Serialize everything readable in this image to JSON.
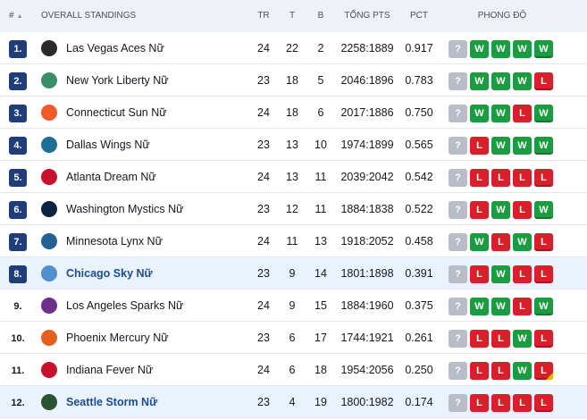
{
  "header": {
    "rank": "#",
    "overall": "OVERALL STANDINGS",
    "tr": "TR",
    "t": "T",
    "b": "B",
    "pts": "TỔNG PTS",
    "pct": "PCT",
    "form": "PHONG ĐỘ"
  },
  "rows": [
    {
      "rank": "1.",
      "team": "Las Vegas Aces Nữ",
      "tr": "24",
      "t": "22",
      "b": "2",
      "pts": "2258:1889",
      "pct": "0.917",
      "form": [
        "?",
        "W",
        "W",
        "W",
        "W"
      ],
      "logo_color": "#2b2b2b",
      "highlight": false,
      "boxed": true
    },
    {
      "rank": "2.",
      "team": "New York Liberty Nữ",
      "tr": "23",
      "t": "18",
      "b": "5",
      "pts": "2046:1896",
      "pct": "0.783",
      "form": [
        "?",
        "W",
        "W",
        "W",
        "L"
      ],
      "logo_color": "#3a8f6b",
      "highlight": false,
      "boxed": true
    },
    {
      "rank": "3.",
      "team": "Connecticut Sun Nữ",
      "tr": "24",
      "t": "18",
      "b": "6",
      "pts": "2017:1886",
      "pct": "0.750",
      "form": [
        "?",
        "W",
        "W",
        "L",
        "W"
      ],
      "logo_color": "#f05a28",
      "highlight": false,
      "boxed": true
    },
    {
      "rank": "4.",
      "team": "Dallas Wings Nữ",
      "tr": "23",
      "t": "13",
      "b": "10",
      "pts": "1974:1899",
      "pct": "0.565",
      "form": [
        "?",
        "L",
        "W",
        "W",
        "W"
      ],
      "logo_color": "#1d6f95",
      "highlight": false,
      "boxed": true
    },
    {
      "rank": "5.",
      "team": "Atlanta Dream Nữ",
      "tr": "24",
      "t": "13",
      "b": "11",
      "pts": "2039:2042",
      "pct": "0.542",
      "form": [
        "?",
        "L",
        "L",
        "L",
        "L"
      ],
      "logo_color": "#c8102e",
      "highlight": false,
      "boxed": true
    },
    {
      "rank": "6.",
      "team": "Washington Mystics Nữ",
      "tr": "23",
      "t": "12",
      "b": "11",
      "pts": "1884:1838",
      "pct": "0.522",
      "form": [
        "?",
        "L",
        "W",
        "L",
        "W"
      ],
      "logo_color": "#0c2340",
      "highlight": false,
      "boxed": true
    },
    {
      "rank": "7.",
      "team": "Minnesota Lynx Nữ",
      "tr": "24",
      "t": "11",
      "b": "13",
      "pts": "1918:2052",
      "pct": "0.458",
      "form": [
        "?",
        "W",
        "L",
        "W",
        "L"
      ],
      "logo_color": "#236192",
      "highlight": false,
      "boxed": true
    },
    {
      "rank": "8.",
      "team": "Chicago Sky Nữ",
      "tr": "23",
      "t": "9",
      "b": "14",
      "pts": "1801:1898",
      "pct": "0.391",
      "form": [
        "?",
        "L",
        "W",
        "L",
        "L"
      ],
      "logo_color": "#5091cd",
      "highlight": true,
      "boxed": true
    },
    {
      "rank": "9.",
      "team": "Los Angeles Sparks Nữ",
      "tr": "24",
      "t": "9",
      "b": "15",
      "pts": "1884:1960",
      "pct": "0.375",
      "form": [
        "?",
        "W",
        "W",
        "L",
        "W"
      ],
      "logo_color": "#702f8a",
      "highlight": false,
      "boxed": false
    },
    {
      "rank": "10.",
      "team": "Phoenix Mercury Nữ",
      "tr": "23",
      "t": "6",
      "b": "17",
      "pts": "1744:1921",
      "pct": "0.261",
      "form": [
        "?",
        "L",
        "L",
        "W",
        "L"
      ],
      "logo_color": "#e56020",
      "highlight": false,
      "boxed": false
    },
    {
      "rank": "11.",
      "team": "Indiana Fever Nữ",
      "tr": "24",
      "t": "6",
      "b": "18",
      "pts": "1954:2056",
      "pct": "0.250",
      "form": [
        "?",
        "L",
        "L",
        "W",
        "L"
      ],
      "logo_color": "#c8102e",
      "highlight": false,
      "boxed": false
    },
    {
      "rank": "12.",
      "team": "Seattle Storm Nữ",
      "tr": "23",
      "t": "4",
      "b": "19",
      "pts": "1800:1982",
      "pct": "0.174",
      "form": [
        "?",
        "L",
        "L",
        "L",
        "L"
      ],
      "logo_color": "#2c5234",
      "highlight": true,
      "boxed": false
    }
  ],
  "colors": {
    "win": "#1d9c3f",
    "loss": "#d8202a",
    "unknown": "#b9bec6",
    "rank_box": "#1f3d7a",
    "highlight_row": "#eaf3fd"
  }
}
